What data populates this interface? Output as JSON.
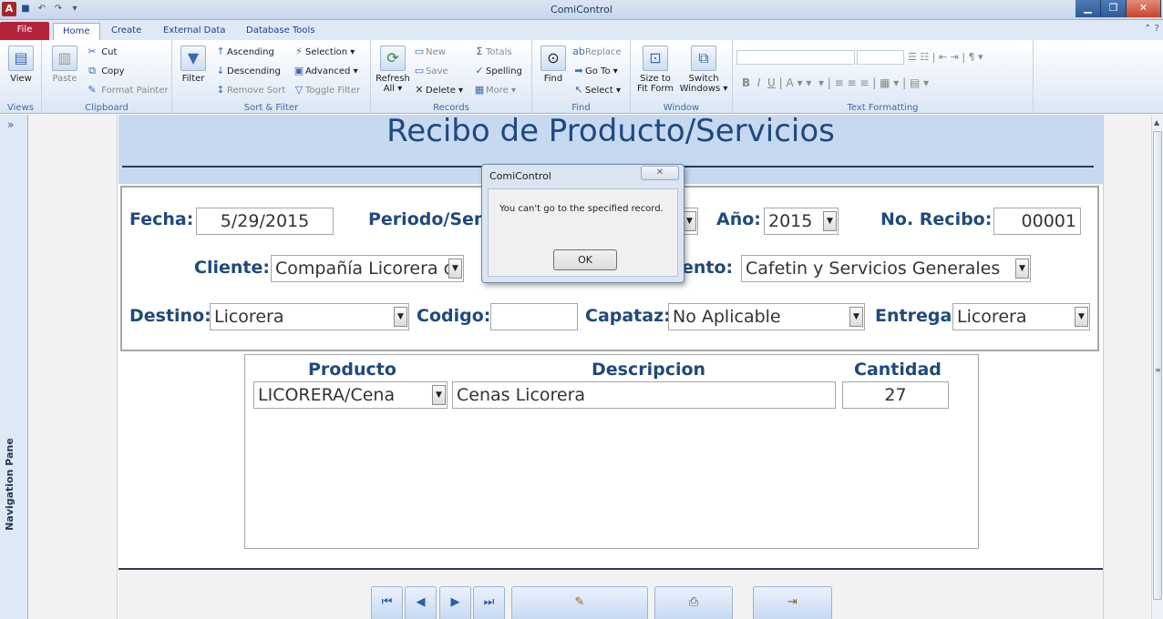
{
  "app": {
    "title": "ComiControl"
  },
  "ribbon_tabs": [
    "File",
    "Home",
    "Create",
    "External Data",
    "Database Tools"
  ],
  "ribbon": {
    "views": {
      "view_label": "View",
      "group": "Views"
    },
    "clipboard": {
      "paste": "Paste",
      "cut": "Cut",
      "copy": "Copy",
      "format_painter": "Format Painter",
      "group": "Clipboard"
    },
    "sort_filter": {
      "filter": "Filter",
      "ascending": "Ascending",
      "descending": "Descending",
      "remove_sort": "Remove Sort",
      "selection": "Selection ▾",
      "advanced": "Advanced ▾",
      "toggle_filter": "Toggle Filter",
      "group": "Sort & Filter"
    },
    "records": {
      "refresh": "Refresh",
      "refresh2": "All ▾",
      "new": "New",
      "save": "Save",
      "delete": "Delete ▾",
      "totals": "Totals",
      "spelling": "Spelling",
      "more": "More ▾",
      "group": "Records"
    },
    "find": {
      "find": "Find",
      "replace": "Replace",
      "goto": "Go To ▾",
      "select": "Select ▾",
      "group": "Find"
    },
    "window": {
      "size_to_fit": "Size to",
      "size_to_fit2": "Fit Form",
      "switch": "Switch",
      "switch2": "Windows ▾",
      "group": "Window"
    },
    "text_formatting": {
      "group": "Text Formatting"
    }
  },
  "nav_pane": {
    "label": "Navigation Pane",
    "toggle": "»"
  },
  "form": {
    "title": "Recibo de Producto/Servicios",
    "fecha_label": "Fecha:",
    "fecha_value": "5/29/2015",
    "periodo_label": "Periodo/Sem",
    "anio_label": "Año:",
    "anio_value": "2015",
    "recibo_label": "No. Recibo:",
    "recibo_value": "00001",
    "cliente_label": "Cliente:",
    "cliente_value": "Compañía Licorera d",
    "departamento_label": "ento:",
    "departamento_value": "Cafetin y Servicios Generales",
    "destino_label": "Destino:",
    "destino_value": "Licorera",
    "codigo_label": "Codigo:",
    "codigo_value": "",
    "capataz_label": "Capataz:",
    "capataz_value": "No Aplicable",
    "entrega_label": "Entrega:",
    "entrega_value": "Licorera"
  },
  "subform": {
    "headers": {
      "producto": "Producto",
      "descripcion": "Descripcion",
      "cantidad": "Cantidad"
    },
    "rows": [
      {
        "producto": "LICORERA/Cena",
        "descripcion": "Cenas Licorera",
        "cantidad": "27"
      }
    ]
  },
  "dialog": {
    "title": "ComiControl",
    "message": "You can't go to the specified record.",
    "ok": "OK"
  }
}
